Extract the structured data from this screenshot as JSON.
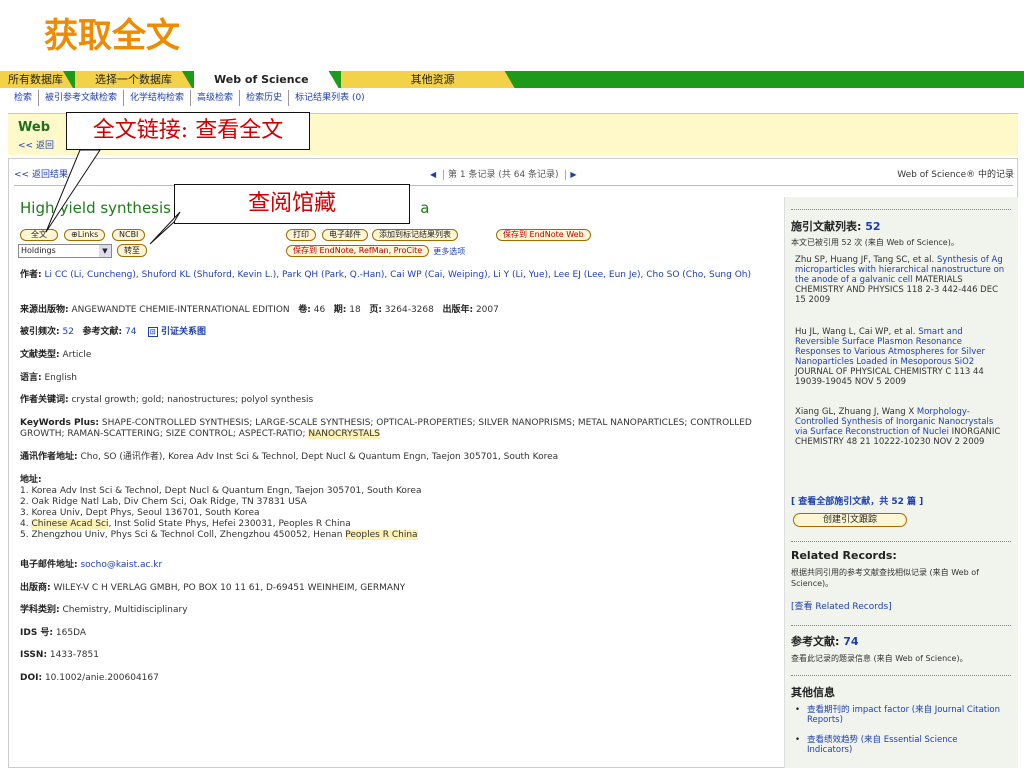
{
  "slide_title": "获取全文",
  "topnav": [
    "所有数据库",
    "选择一个数据库",
    "Web of Science",
    "其他资源"
  ],
  "subnav": [
    "检索",
    "被引参考文献检索",
    "化学结构检索",
    "高级检索",
    "检索历史",
    "标记结果列表 (0)"
  ],
  "banner": {
    "title": "Web",
    "back": "<< 返回"
  },
  "callouts": {
    "fulltext": "全文链接: 查看全文",
    "holdings": "查阅馆藏"
  },
  "record_nav": {
    "back": "<< 返回结果",
    "pager": "第 1 条记录 (共 64 条记录)",
    "wos": "Web of Science® 中的记录"
  },
  "title": "High-yield synthesis of",
  "title_end": "a",
  "buttons": {
    "fulltext": "全文",
    "links": "⊕Links",
    "ncbi": "NCBI",
    "print": "打印",
    "email": "电子邮件",
    "mark": "添加到标记结果列表",
    "save": "保存到 EndNote Web",
    "save2": "保存到 EndNote, RefMan, ProCite",
    "more": "更多选项",
    "goto": "转至"
  },
  "holdings": "Holdings",
  "record": {
    "authors_label": "作者:",
    "authors": "Li CC (Li, Cuncheng), Shuford KL (Shuford, Kevin L.), Park QH (Park, Q.-Han), Cai WP (Cai, Weiping), Li Y (Li, Yue), Lee EJ (Lee, Eun Je), Cho SO (Cho, Sung Oh)",
    "source_label": "来源出版物:",
    "source": "ANGEWANDTE CHEMIE-INTERNATIONAL EDITION",
    "volume_label": "卷:",
    "volume": "46",
    "issue_label": "期:",
    "issue": "18",
    "pages_label": "页:",
    "pages": "3264-3268",
    "year_label": "出版年:",
    "year": "2007",
    "cited_label": "被引频次:",
    "cited": "52",
    "refs_label": "参考文献:",
    "refs": "74",
    "map": "引证关系图",
    "doctype_label": "文献类型:",
    "doctype": "Article",
    "lang_label": "语言:",
    "lang": "English",
    "kw_label": "作者关键词:",
    "kw": "crystal growth; gold; nanostructures; polyol synthesis",
    "kwplus_label": "KeyWords Plus:",
    "kwplus": "SHAPE-CONTROLLED SYNTHESIS; LARGE-SCALE SYNTHESIS; OPTICAL-PROPERTIES; SILVER NANOPRISMS; METAL NANOPARTICLES; CONTROLLED GROWTH; RAMAN-SCATTERING; SIZE CONTROL; ASPECT-RATIO;",
    "kwplus_hl": "NANOCRYSTALS",
    "corr_label": "通讯作者地址:",
    "corr": "Cho, SO (通讯作者), Korea Adv Inst Sci & Technol, Dept Nucl & Quantum Engn, Taejon 305701, South Korea",
    "addr_label": "地址:",
    "addr": [
      "1. Korea Adv Inst Sci & Technol, Dept Nucl & Quantum Engn, Taejon 305701, South Korea",
      "2. Oak Ridge Natl Lab, Div Chem Sci, Oak Ridge, TN 37831 USA",
      "3. Korea Univ, Dept Phys, Seoul 136701, South Korea"
    ],
    "addr4_a": "4.",
    "addr4_hl": "Chinese Acad Sci",
    "addr4_b": ", Inst Solid State Phys, Hefei 230031, Peoples R China",
    "addr5_a": "5. Zhengzhou Univ, Phys Sci & Technol Coll, Zhengzhou 450052, Henan",
    "addr5_hl": "Peoples R China",
    "email_label": "电子邮件地址:",
    "email": "socho@kaist.ac.kr",
    "pub_label": "出版商:",
    "pub": "WILEY-V C H VERLAG GMBH, PO BOX 10 11 61, D-69451 WEINHEIM, GERMANY",
    "subj_label": "学科类别:",
    "subj": "Chemistry, Multidisciplinary",
    "ids_label": "IDS 号:",
    "ids": "165DA",
    "issn_label": "ISSN:",
    "issn": "1433-7851",
    "doi_label": "DOI:",
    "doi": "10.1002/anie.200604167"
  },
  "sidebar": {
    "cite_h": "施引文献列表:",
    "cite_n": "52",
    "cite_t": "本文已被引用 52 次 (来自 Web of Science)。",
    "c1a": "Zhu SP, Huang JF, Tang SC, et al.",
    "c1b": "Synthesis of Ag microparticles with hierarchical nanostructure on the anode of a galvanic cell",
    "c1c": "MATERIALS CHEMISTRY AND PHYSICS 118 2-3 442-446 DEC 15 2009",
    "c2a": "Hu JL, Wang L, Cai WP, et al.",
    "c2b": "Smart and Reversible Surface Plasmon Resonance Responses to Various Atmospheres for Silver Nanoparticles Loaded in Mesoporous SiO2",
    "c2c": "JOURNAL OF PHYSICAL CHEMISTRY C 113 44 19039-19045 NOV 5 2009",
    "c3a": "Xiang GL, Zhuang J, Wang X",
    "c3b": "Morphology-Controlled Synthesis of Inorganic Nanocrystals via Surface Reconstruction of Nuclei",
    "c3c": "INORGANIC CHEMISTRY 48 21 10222-10230 NOV 2 2009",
    "view_all": "[ 查看全部施引文献，共 52 篇 ]",
    "alert": "创建引文跟踪",
    "rel_h": "Related Records:",
    "rel_t": "根据共同引用的参考文献查找相似记录 (来自 Web of Science)。",
    "rel_link": "[查看 Related Records]",
    "ref_h": "参考文献:",
    "ref_n": "74",
    "ref_t": "查看此记录的题录信息 (来自 Web of Science)。",
    "other_h": "其他信息",
    "o1": "查看期刊的 impact factor (来自 Journal Citation Reports)",
    "o2": "查看绩效趋势 (来自 Essential Science Indicators)"
  }
}
